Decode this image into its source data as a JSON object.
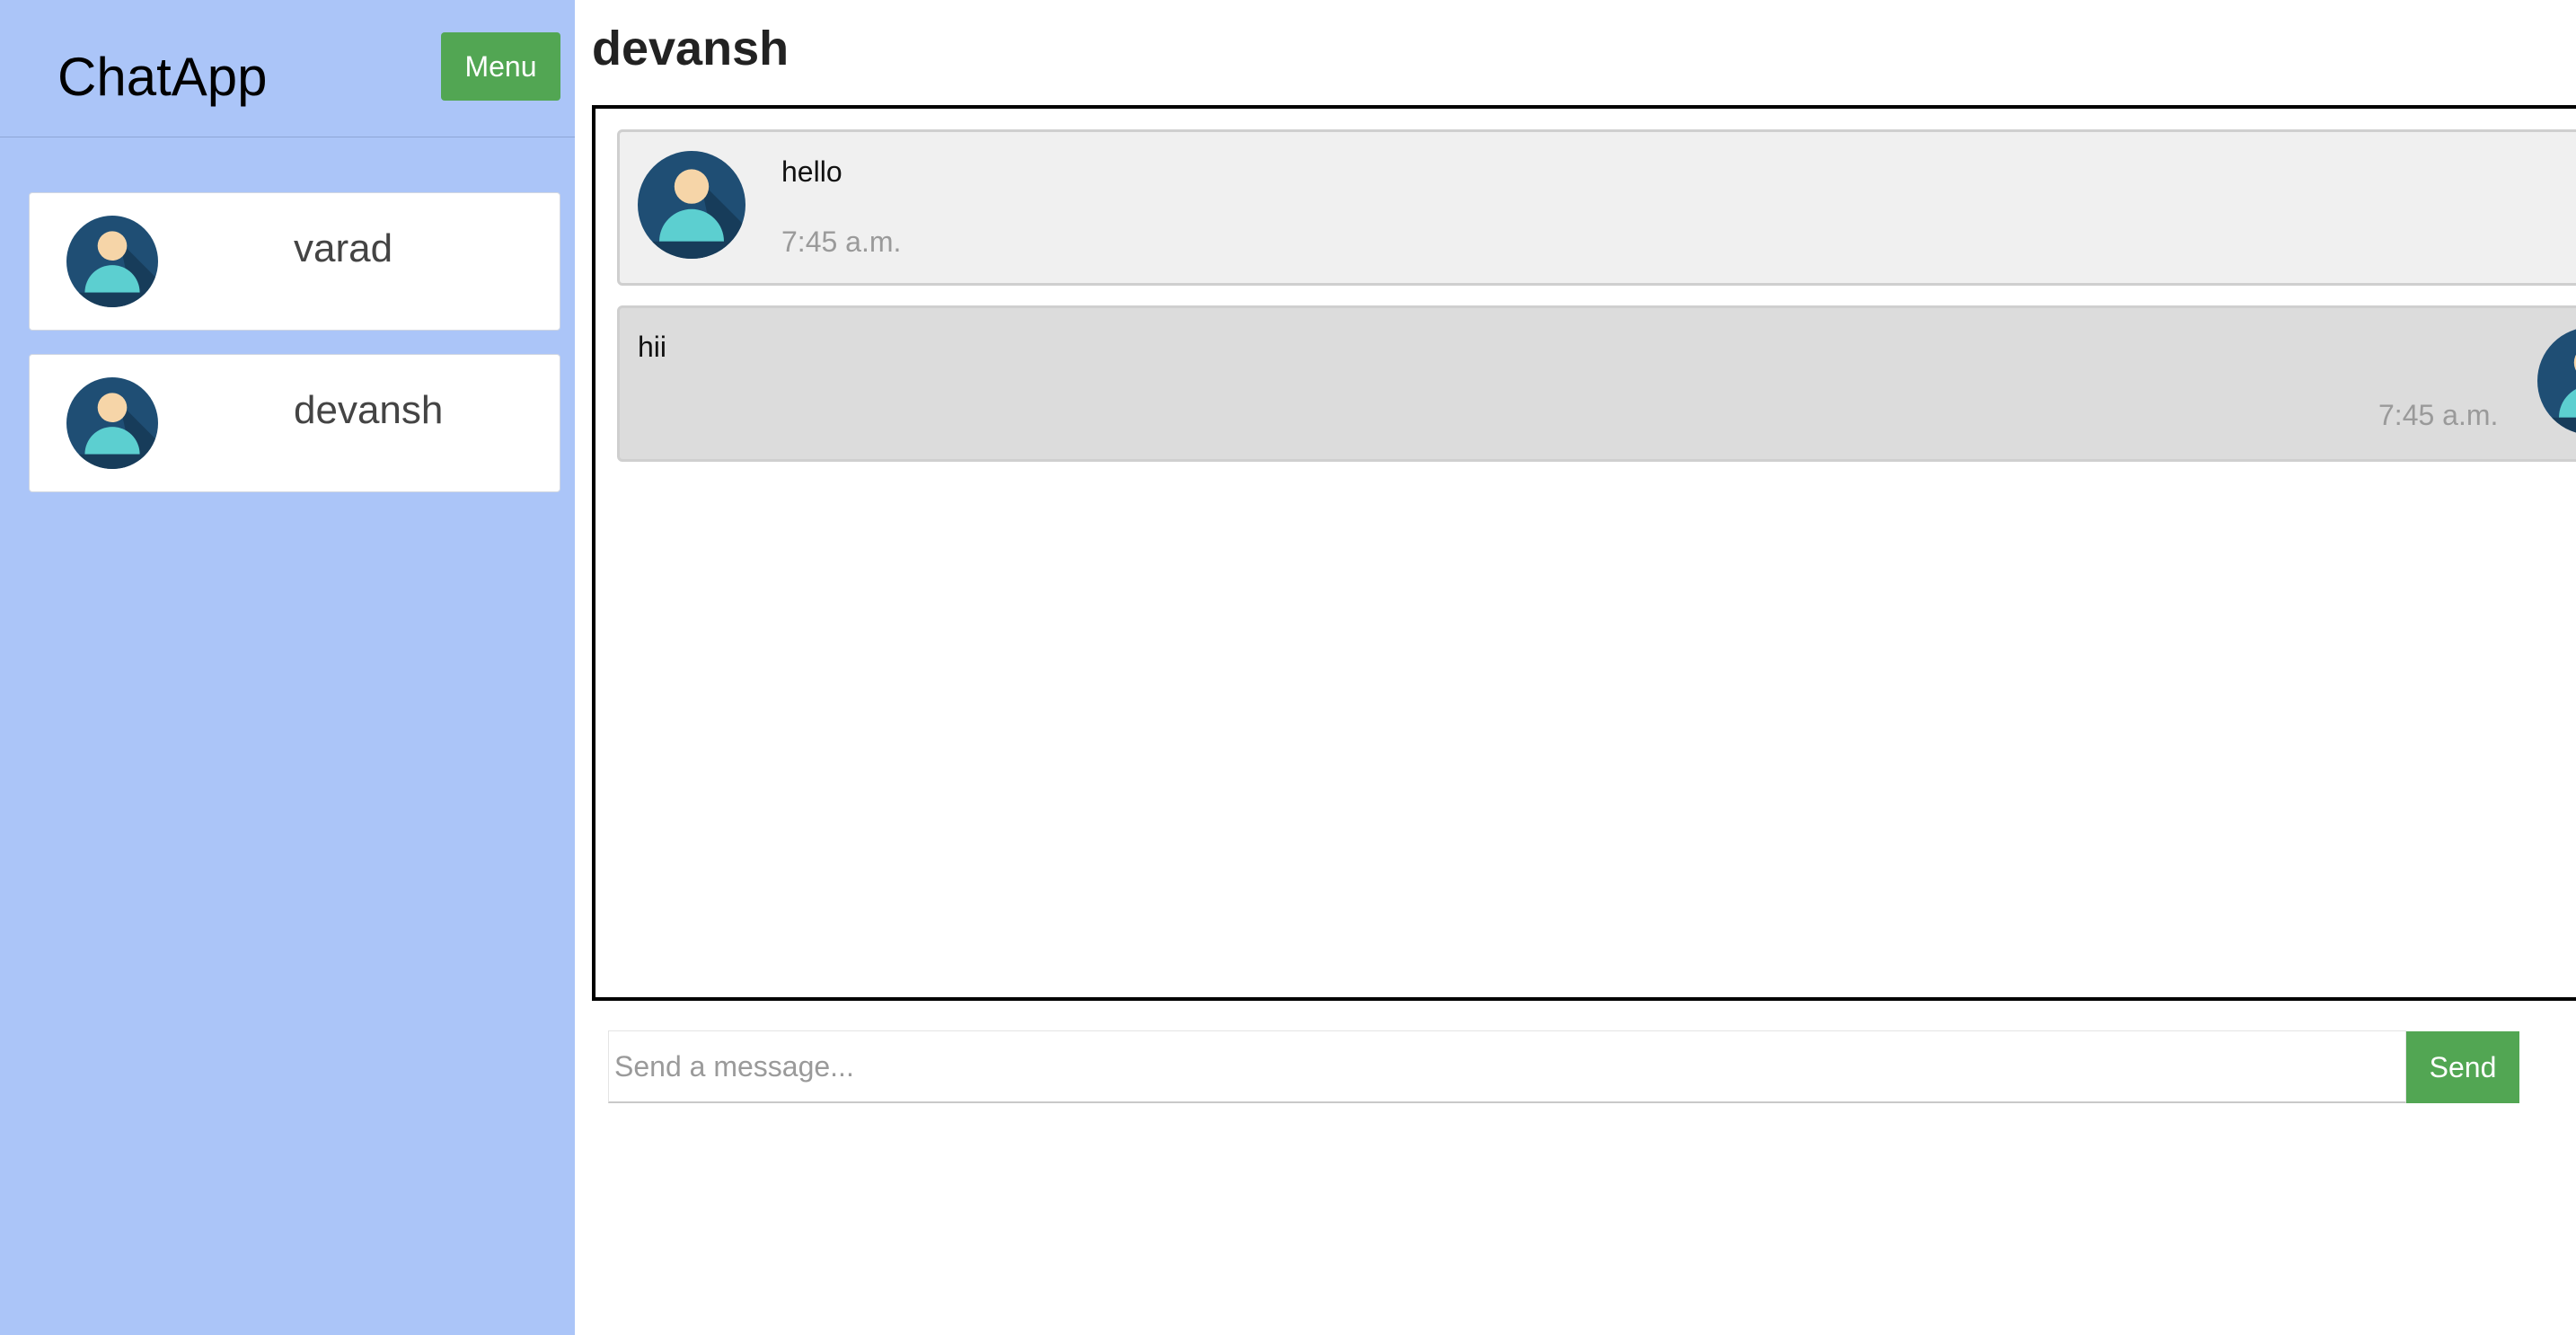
{
  "sidebar": {
    "app_title": "ChatApp",
    "menu_label": "Menu",
    "contacts": [
      {
        "name": "varad",
        "avatar": "user-avatar-icon"
      },
      {
        "name": "devansh",
        "avatar": "user-avatar-icon"
      }
    ]
  },
  "chat": {
    "title": "devansh",
    "messages": [
      {
        "direction": "received",
        "text": "hello",
        "time": "7:45 a.m.",
        "avatar": "user-avatar-icon"
      },
      {
        "direction": "sent",
        "text": "hii",
        "time": "7:45 a.m.",
        "avatar": "user-avatar-icon"
      }
    ]
  },
  "composer": {
    "placeholder": "Send a message...",
    "value": "",
    "send_label": "Send"
  },
  "colors": {
    "sidebar_bg": "#abc5f8",
    "accent_green": "#52a653",
    "avatar_bg": "#1f4e74",
    "avatar_body": "#5ccfd0",
    "avatar_skin": "#f6d5a8"
  }
}
